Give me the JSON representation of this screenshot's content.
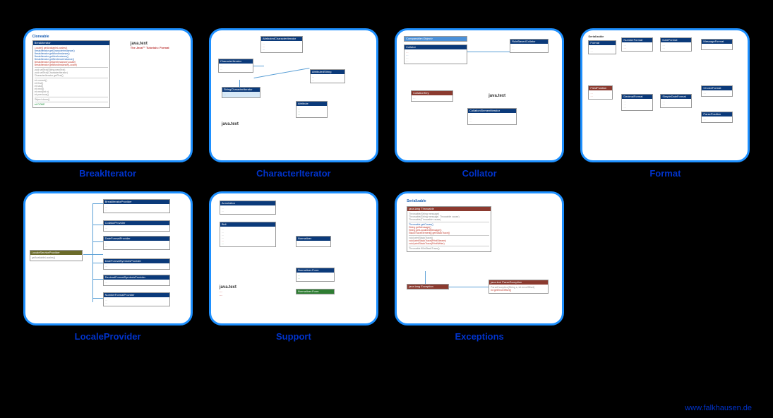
{
  "footer": "www.falkhausen.de",
  "cards": [
    {
      "caption": "BreakIterator"
    },
    {
      "caption": "CharacterIterator"
    },
    {
      "caption": "Collator"
    },
    {
      "caption": "Format"
    },
    {
      "caption": "LocaleProvider"
    },
    {
      "caption": "Support"
    },
    {
      "caption": "Exceptions"
    }
  ],
  "pkgLabel": "java.text",
  "pkgSub": "The Java™ Tutorials: Format",
  "c1": {
    "cloneable": "Cloneable",
    "title": "BreakIterator",
    "rows": [
      "Locale[] getAvailableLocales()",
      "BreakIterator getCharacterInstance()",
      "BreakIterator getWordInstance()",
      "BreakIterator getLineInstance()",
      "BreakIterator getSentenceInstance()",
      "BreakIterator getLineInstance(Locale)",
      "BreakIterator getWordInstance(Locale)",
      "void setText(String newText)",
      "void setText(CharacterIterator)",
      "CharacterIterator getText()",
      "int current()",
      "int first()",
      "int last()",
      "int next()",
      "int next(int n)",
      "int previous()",
      "Object clone()"
    ],
    "done": "int DONE"
  },
  "c2": {
    "boxes": [
      "AttributedCharacterIterator",
      "CharacterIterator",
      "StringCharacterIterator",
      "AttributedString",
      "Attribute"
    ]
  },
  "c3": {
    "boxes": [
      "Comparable<Object>",
      "Collator",
      "RuleBasedCollator",
      "CollationKey",
      "CollationElementIterator"
    ]
  },
  "c4": {
    "boxes": [
      "Serializable",
      "Format",
      "NumberFormat",
      "DecimalFormat",
      "DateFormat",
      "SimpleDateFormat",
      "MessageFormat",
      "ChoiceFormat",
      "FieldPosition",
      "ParsePosition"
    ]
  },
  "c5": {
    "main": "LocaleServiceProvider",
    "rows": [
      "BreakIteratorProvider",
      "CollatorProvider",
      "DateFormatProvider",
      "DateFormatSymbolsProvider",
      "DecimalFormatSymbolsProvider",
      "NumberFormatProvider"
    ]
  },
  "c6": {
    "boxes": [
      "Annotation",
      "Bidi",
      "Normalizer",
      "Normalizer.Form"
    ]
  },
  "c7": {
    "serializable": "Serializable",
    "throwable": "java.lang Throwable",
    "throwRows": [
      "Throwable(String message)",
      "Throwable(String message, Throwable cause)",
      "Throwable(Throwable cause)",
      "Throwable getCause()",
      "String getMessage()",
      "String getLocalizedMessage()",
      "StackTraceElement[] getStackTrace()",
      "void printStackTrace()",
      "void printStackTrace(PrintStream)",
      "void printStackTrace(PrintWriter)",
      "Throwable fillInStackTrace()"
    ],
    "exception": "java.lang Exception",
    "parseException": "java.text ParseException",
    "parseRows": [
      "ParseException(String s, int errorOffset)",
      "int getErrorOffset()"
    ]
  }
}
